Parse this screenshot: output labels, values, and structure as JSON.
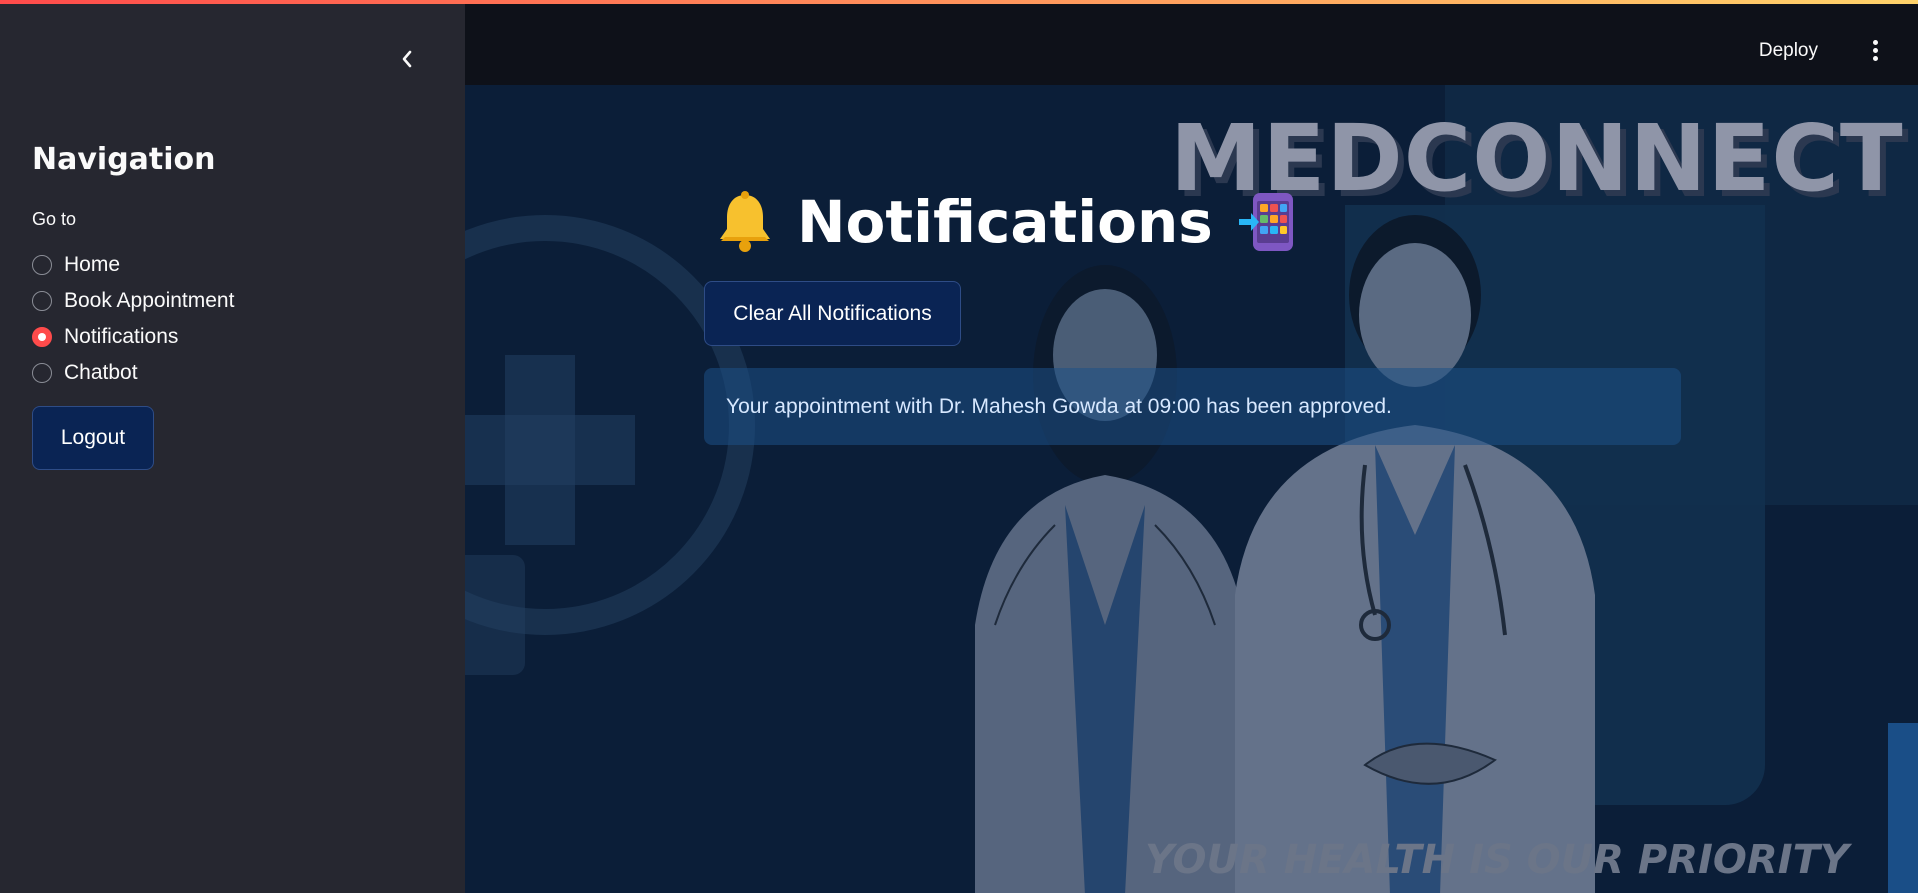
{
  "header": {
    "deploy_label": "Deploy",
    "menu_icon": "kebab-menu-icon"
  },
  "sidebar": {
    "collapse_icon": "chevron-left-icon",
    "title": "Navigation",
    "radio_label": "Go to",
    "options": [
      {
        "label": "Home",
        "selected": false
      },
      {
        "label": "Book Appointment",
        "selected": false
      },
      {
        "label": "Notifications",
        "selected": true
      },
      {
        "label": "Chatbot",
        "selected": false
      }
    ],
    "logout_label": "Logout"
  },
  "main": {
    "brand": "MEDCONNECT",
    "tagline": "YOUR HEALTH IS OUR PRIORITY",
    "heading": "Notifications",
    "heading_icon_left": "bell-icon",
    "heading_icon_right": "app-grid-incoming-icon",
    "clear_button_label": "Clear All Notifications",
    "notifications": [
      "Your appointment with Dr. Mahesh Gowda at 09:00 has been approved."
    ]
  },
  "colors": {
    "accent": "#ff4b4b",
    "sidebar_bg": "#262730",
    "header_bg": "#0e1119",
    "main_bg": "#0b1e38",
    "button_bg": "#0a2454"
  }
}
